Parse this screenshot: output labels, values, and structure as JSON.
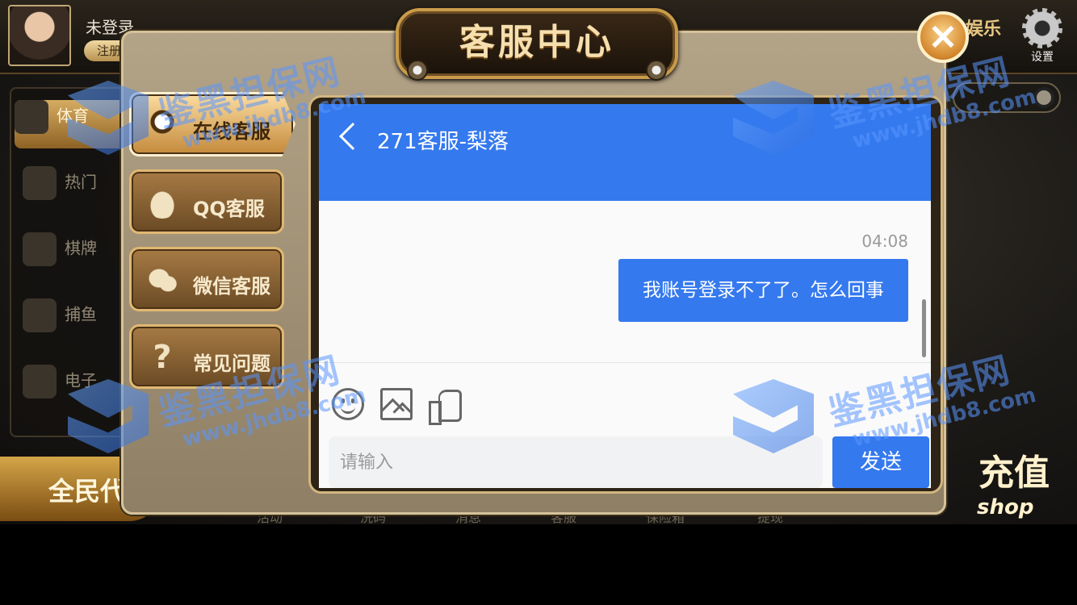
{
  "lobby": {
    "user_name": "未登录",
    "register_label": "注册",
    "brand_text": "娱乐",
    "settings_label": "设置",
    "side_items": [
      {
        "label": "体育",
        "icon": "soccer-ball-icon",
        "active": true
      },
      {
        "label": "热门",
        "icon": "hot-flame-icon",
        "active": false
      },
      {
        "label": "棋牌",
        "icon": "playing-cards-icon",
        "active": false
      },
      {
        "label": "捕鱼",
        "icon": "fish-icon",
        "active": false
      },
      {
        "label": "电子",
        "icon": "slot-machine-icon",
        "active": false
      }
    ],
    "promo_label": "全民代",
    "recharge_label": "充值",
    "recharge_sub": "shop",
    "bottom_nav": [
      "活动",
      "洗码",
      "消息",
      "客服",
      "保险箱",
      "提现"
    ]
  },
  "dialog": {
    "title": "客服中心",
    "close_icon": "close-icon",
    "menu": [
      {
        "label": "在线客服",
        "icon": "headset-agent-icon",
        "active": true
      },
      {
        "label": "QQ客服",
        "icon": "qq-penguin-icon",
        "active": false
      },
      {
        "label": "微信客服",
        "icon": "wechat-icon",
        "active": false
      },
      {
        "label": "常见问题",
        "icon": "question-mark-icon",
        "active": false
      }
    ]
  },
  "chat": {
    "title": "271客服-梨落",
    "timestamp": "04:08",
    "message": "我账号登录不了了。怎么回事",
    "input_placeholder": "请输入",
    "send_label": "发送",
    "tools": [
      "emoji-icon",
      "image-icon",
      "like-icon"
    ],
    "accent": "#3479ee"
  },
  "watermark": {
    "name": "鉴黑担保网",
    "url": "www.jhdb8.com"
  }
}
